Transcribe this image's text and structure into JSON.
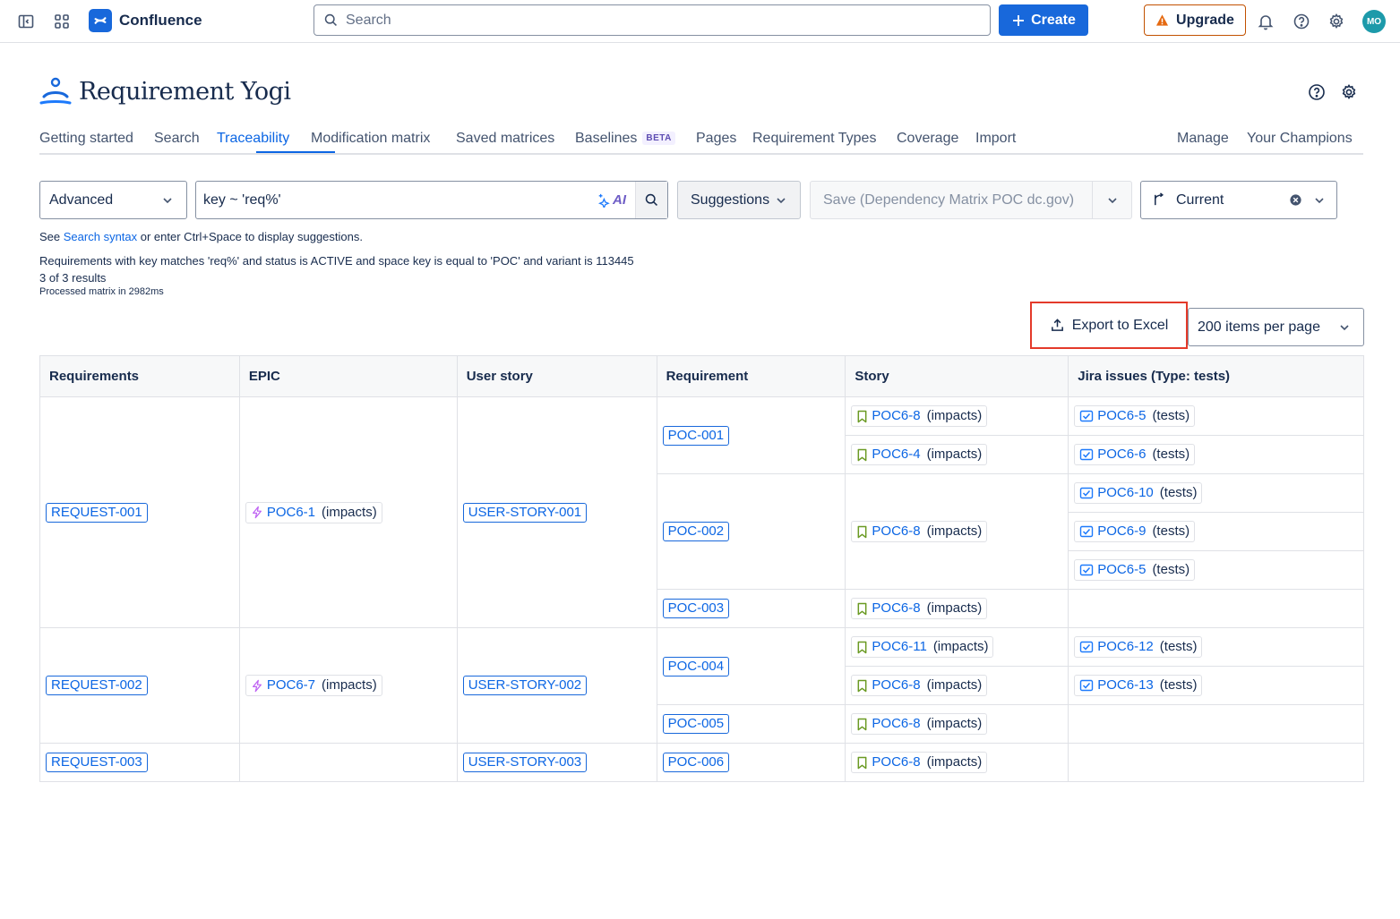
{
  "topbar": {
    "app_name": "Confluence",
    "search_placeholder": "Search",
    "create_label": "Create",
    "upgrade_label": "Upgrade",
    "avatar_initials": "MO"
  },
  "app": {
    "title": "Requirement Yogi"
  },
  "nav": {
    "tabs": [
      "Getting started",
      "Search",
      "Traceability",
      "Modification matrix",
      "Saved matrices",
      "Baselines",
      "Pages",
      "Requirement Types",
      "Coverage",
      "Import"
    ],
    "right_tabs": [
      "Manage",
      "Your Champions"
    ],
    "beta_badge": "BETA",
    "active_tab": "Traceability"
  },
  "query": {
    "mode": "Advanced",
    "value": "key ~ 'req%'",
    "ai_label": "AI",
    "suggestions_label": "Suggestions",
    "save_label": "Save (Dependency Matrix POC dc.gov)",
    "version_label": "Current",
    "hint_prefix": "See",
    "hint_link": "Search syntax",
    "hint_suffix": "or enter Ctrl+Space to display suggestions.",
    "description": "Requirements with key matches 'req%' and status is ACTIVE and space key is equal to 'POC' and variant is 113445",
    "results": "3 of 3 results",
    "processed": "Processed matrix in 2982ms"
  },
  "toolbar": {
    "export_label": "Export to Excel",
    "per_page_label": "200 items per page"
  },
  "table": {
    "headers": [
      "Requirements",
      "EPIC",
      "User story",
      "Requirement",
      "Story",
      "Jira issues (Type: tests)"
    ],
    "requests": [
      "REQUEST-001",
      "REQUEST-002",
      "REQUEST-003"
    ],
    "epics": [
      {
        "key": "POC6-1",
        "rel": "(impacts)"
      },
      {
        "key": "POC6-7",
        "rel": "(impacts)"
      }
    ],
    "user_stories": [
      "USER-STORY-001",
      "USER-STORY-002",
      "USER-STORY-003"
    ],
    "requirements": [
      "POC-001",
      "POC-002",
      "POC-003",
      "POC-004",
      "POC-005",
      "POC-006"
    ],
    "stories": [
      {
        "key": "POC6-8",
        "rel": "(impacts)"
      },
      {
        "key": "POC6-4",
        "rel": "(impacts)"
      },
      {
        "key": "POC6-8",
        "rel": "(impacts)"
      },
      {
        "key": "POC6-8",
        "rel": "(impacts)"
      },
      {
        "key": "POC6-11",
        "rel": "(impacts)"
      },
      {
        "key": "POC6-8",
        "rel": "(impacts)"
      },
      {
        "key": "POC6-8",
        "rel": "(impacts)"
      },
      {
        "key": "POC6-8",
        "rel": "(impacts)"
      }
    ],
    "tests": [
      {
        "key": "POC6-5",
        "rel": "(tests)"
      },
      {
        "key": "POC6-6",
        "rel": "(tests)"
      },
      {
        "key": "POC6-10",
        "rel": "(tests)"
      },
      {
        "key": "POC6-9",
        "rel": "(tests)"
      },
      {
        "key": "POC6-5",
        "rel": "(tests)"
      },
      {
        "key": "POC6-12",
        "rel": "(tests)"
      },
      {
        "key": "POC6-13",
        "rel": "(tests)"
      }
    ]
  },
  "colors": {
    "primary": "#1868db",
    "link": "#0c66e4",
    "highlight": "#e43a2a",
    "story_icon": "#6a9a23",
    "epic_icon": "#bf63f3",
    "upgrade_border": "#c25100"
  }
}
